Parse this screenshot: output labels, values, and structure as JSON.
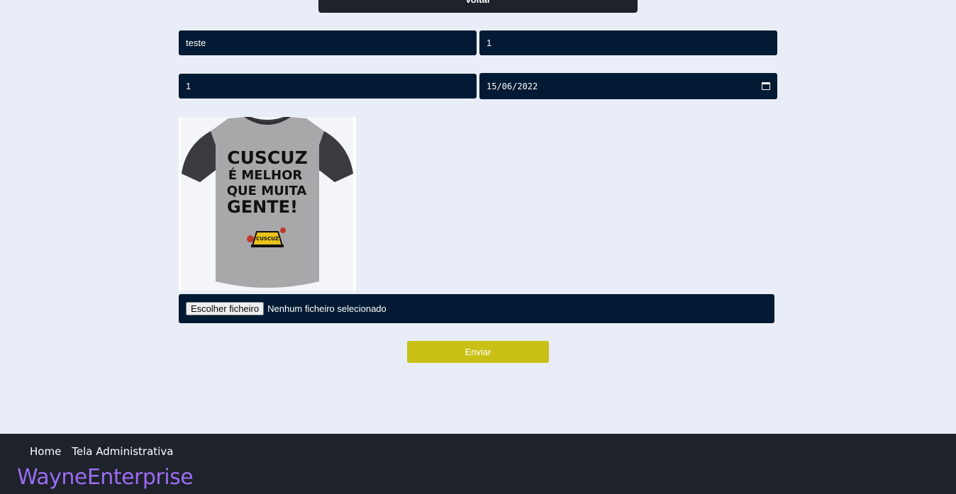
{
  "top": {
    "back_label": "Voltar"
  },
  "form": {
    "name_value": "teste",
    "quantity_value": "1",
    "price_value": "1",
    "date_value": "15/06/2022",
    "file_button_label": "Escolher ficheiro",
    "file_status": "Nenhum ficheiro selecionado",
    "submit_label": "Enviar"
  },
  "preview": {
    "lines": [
      "CUSCUZ",
      "É MELHOR",
      "QUE MUITA",
      "GENTE!"
    ],
    "badge": "CUSCUZ"
  },
  "footer": {
    "nav": [
      "Home",
      "Tela Administrativa"
    ],
    "brand": "WayneEnterprise"
  },
  "colors": {
    "page_bg": "#e9edf7",
    "input_bg": "#021a33",
    "submit_bg": "#c9c015",
    "footer_bg": "#1e222b",
    "brand": "#9b6cf2"
  }
}
